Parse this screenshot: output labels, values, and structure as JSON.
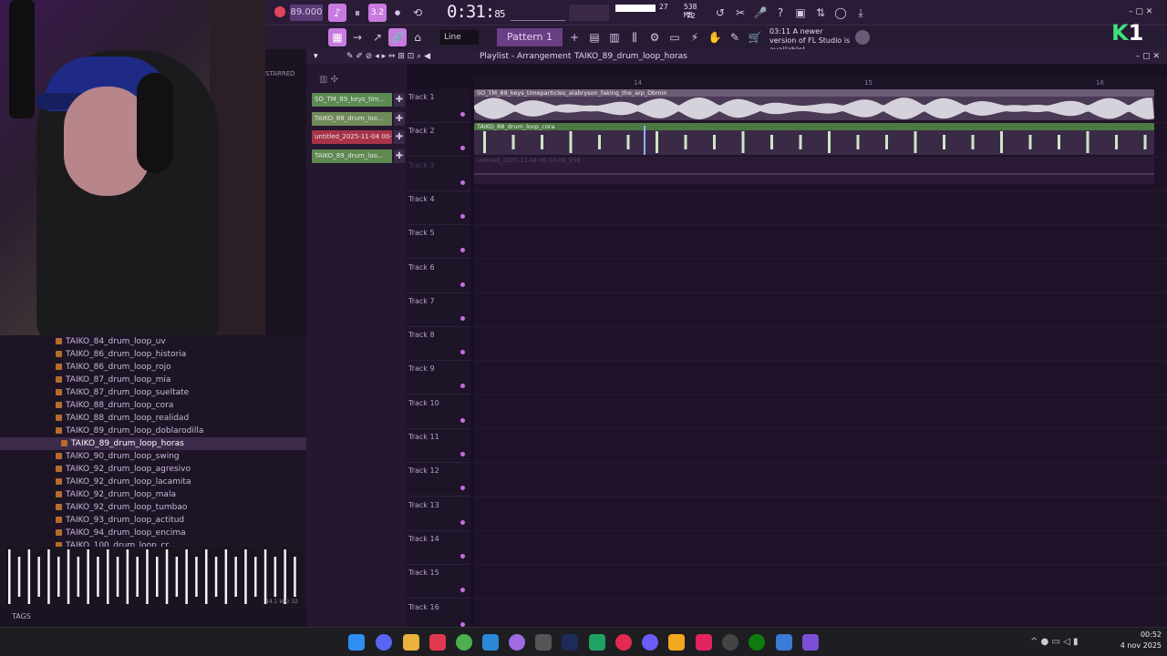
{
  "toolbar": {
    "tempo": "89.000",
    "time_main": "0:31:",
    "time_small": "85",
    "cpu_voices": "27",
    "ram": "538 MB",
    "cpu_polyphony": "72",
    "snap": "Line",
    "pattern": "Pattern 1",
    "news_time": "03:11",
    "news_text": "A newer version of FL Studio is available!"
  },
  "playlist": {
    "title": "Playlist - Arrangement",
    "arrangement": "TAIKO_89_drum_loop_horas",
    "ruler": [
      "14",
      "15",
      "16"
    ],
    "tracks": [
      "Track 1",
      "Track 2",
      "Track 3",
      "Track 4",
      "Track 5",
      "Track 6",
      "Track 7",
      "Track 8",
      "Track 9",
      "Track 10",
      "Track 11",
      "Track 12",
      "Track 13",
      "Track 14",
      "Track 15",
      "Track 16"
    ],
    "clips": [
      {
        "label": "SO_TM_89_keys_timeparticles_alabryson_faking_the_arp_Dbmin",
        "color": "#6b5b73"
      },
      {
        "label": "TAIKO_88_drum_loop_cora",
        "color": "#4c7a44"
      },
      {
        "label": "untitled_2025-11-04 00-50-09_V08",
        "color": "#3a2547"
      }
    ]
  },
  "channels": [
    {
      "label": "SO_TM_89_keys_tim...",
      "color": "#5c8a54"
    },
    {
      "label": "TAIKO_88_drum_loo...",
      "color": "#6f8a5a"
    },
    {
      "label": "untitled_2025-11-04 00-...",
      "color": "#a83347"
    },
    {
      "label": "TAIKO_89_drum_loo...",
      "color": "#5e8a50"
    }
  ],
  "browser": {
    "starred": "STARRED",
    "files": [
      "TAIKO_84_drum_loop_uv",
      "TAIKO_86_drum_loop_historia",
      "TAIKO_86_drum_loop_rojo",
      "TAIKO_87_drum_loop_mia",
      "TAIKO_87_drum_loop_sueltate",
      "TAIKO_88_drum_loop_cora",
      "TAIKO_88_drum_loop_realidad",
      "TAIKO_89_drum_loop_doblarodilla",
      "TAIKO_89_drum_loop_horas",
      "TAIKO_90_drum_loop_swing",
      "TAIKO_92_drum_loop_agresivo",
      "TAIKO_92_drum_loop_lacamita",
      "TAIKO_92_drum_loop_mala",
      "TAIKO_92_drum_loop_tumbao",
      "TAIKO_93_drum_loop_actitud",
      "TAIKO_94_drum_loop_encima",
      "TAIKO_100_drum_loop_cr..."
    ],
    "selected_index": 8,
    "tags_label": "TAGS",
    "preview_info": "44.1 kHz 32"
  },
  "clock": {
    "time": "00:52",
    "date": "4 nov 2025"
  }
}
